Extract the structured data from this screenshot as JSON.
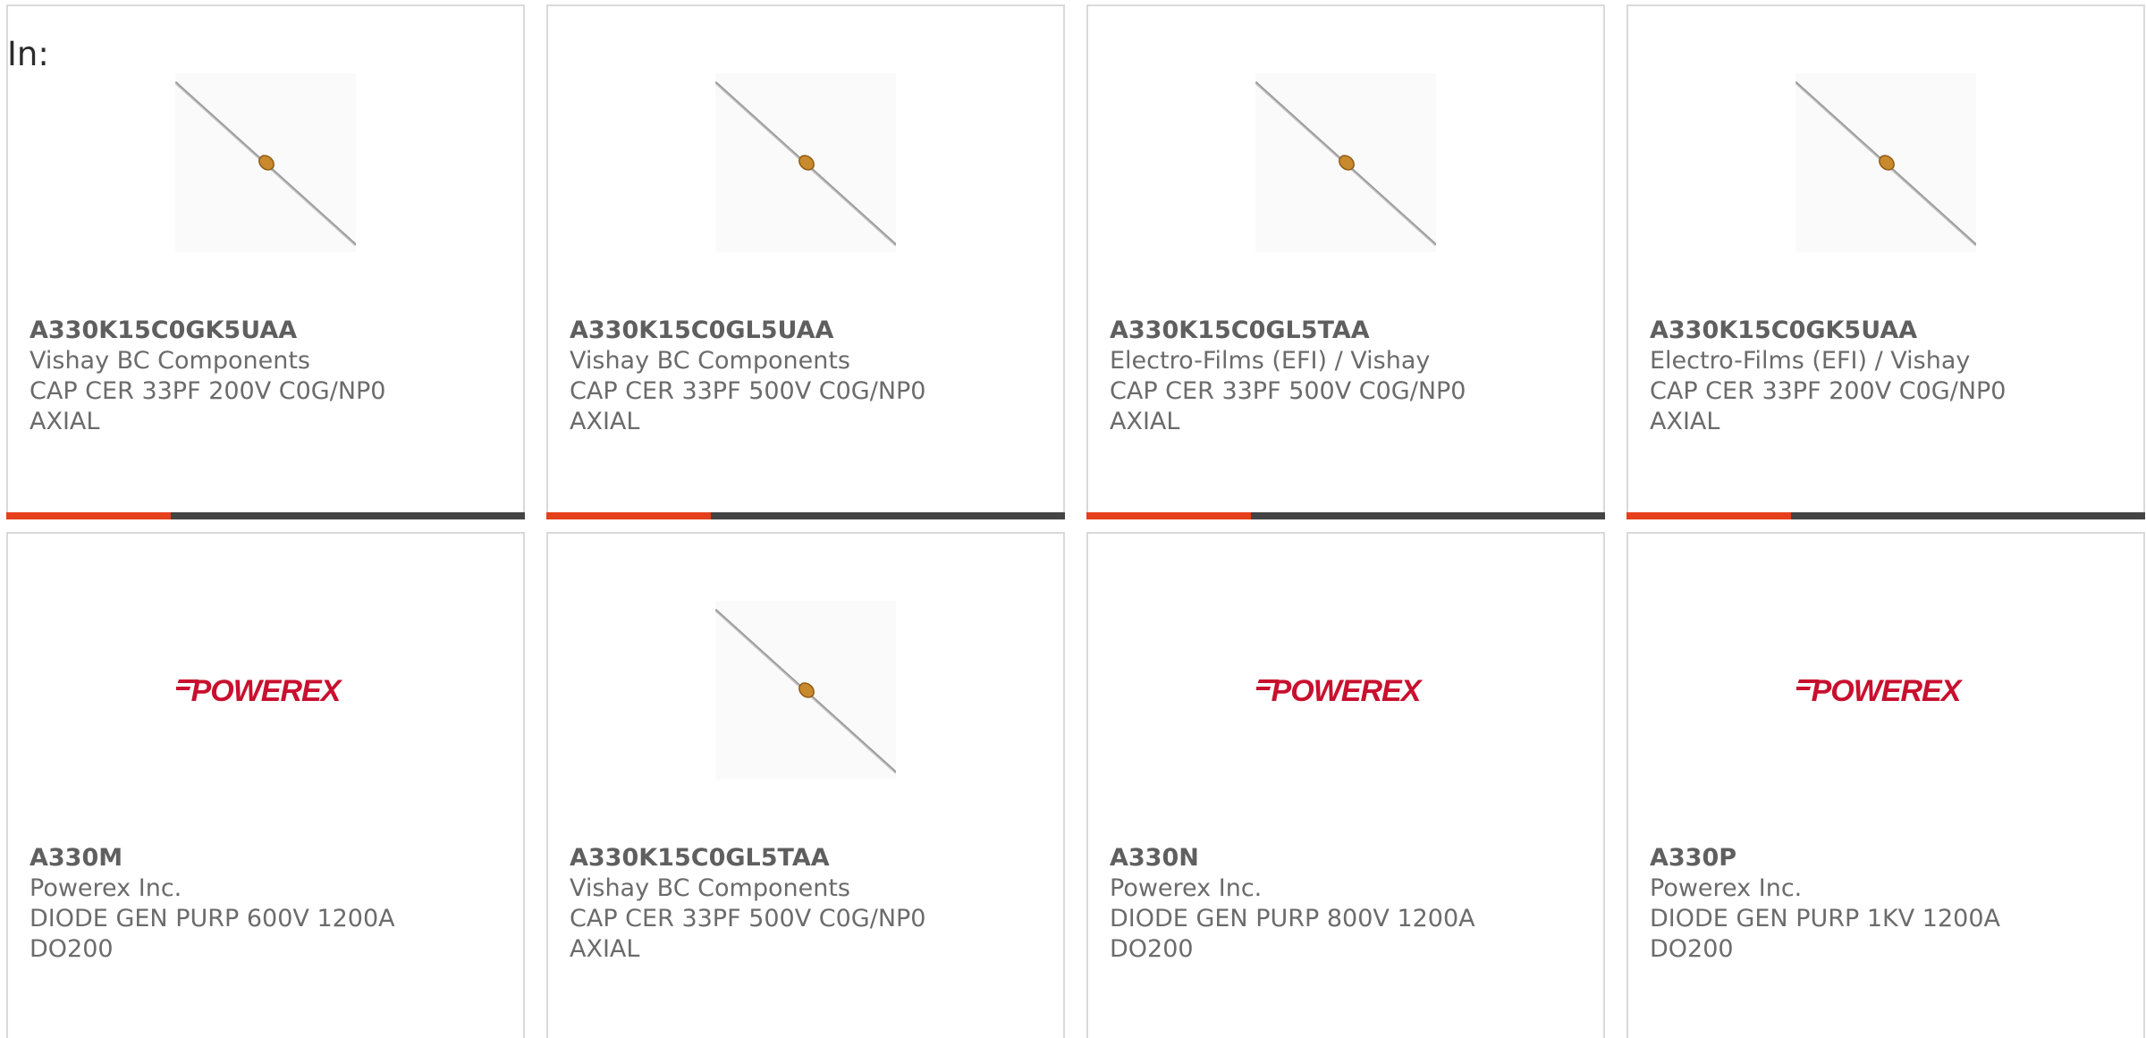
{
  "header": {
    "label": "In:"
  },
  "colors": {
    "accent": "#e4401c",
    "bar_dark": "#444444",
    "logo_red": "#c8102e"
  },
  "products": [
    {
      "part": "A330K15C0GK5UAA",
      "manufacturer": "Vishay BC Components",
      "desc1": "CAP CER 33PF 200V C0G/NP0",
      "desc2": "AXIAL",
      "image": "capacitor-axial"
    },
    {
      "part": "A330K15C0GL5UAA",
      "manufacturer": "Vishay BC Components",
      "desc1": "CAP CER 33PF 500V C0G/NP0",
      "desc2": "AXIAL",
      "image": "capacitor-axial"
    },
    {
      "part": "A330K15C0GL5TAA",
      "manufacturer": "Electro-Films (EFI) / Vishay",
      "desc1": "CAP CER 33PF 500V C0G/NP0",
      "desc2": "AXIAL",
      "image": "capacitor-axial"
    },
    {
      "part": "A330K15C0GK5UAA",
      "manufacturer": "Electro-Films (EFI) / Vishay",
      "desc1": "CAP CER 33PF 200V C0G/NP0",
      "desc2": "AXIAL",
      "image": "capacitor-axial"
    },
    {
      "part": "A330M",
      "manufacturer": "Powerex Inc.",
      "desc1": "DIODE GEN PURP 600V 1200A",
      "desc2": "DO200",
      "image": "powerex-logo",
      "logo_text": "POWEREX"
    },
    {
      "part": "A330K15C0GL5TAA",
      "manufacturer": "Vishay BC Components",
      "desc1": "CAP CER 33PF 500V C0G/NP0",
      "desc2": "AXIAL",
      "image": "capacitor-axial"
    },
    {
      "part": "A330N",
      "manufacturer": "Powerex Inc.",
      "desc1": "DIODE GEN PURP 800V 1200A",
      "desc2": "DO200",
      "image": "powerex-logo",
      "logo_text": "POWEREX"
    },
    {
      "part": "A330P",
      "manufacturer": "Powerex Inc.",
      "desc1": "DIODE GEN PURP 1KV 1200A",
      "desc2": "DO200",
      "image": "powerex-logo",
      "logo_text": "POWEREX"
    }
  ]
}
